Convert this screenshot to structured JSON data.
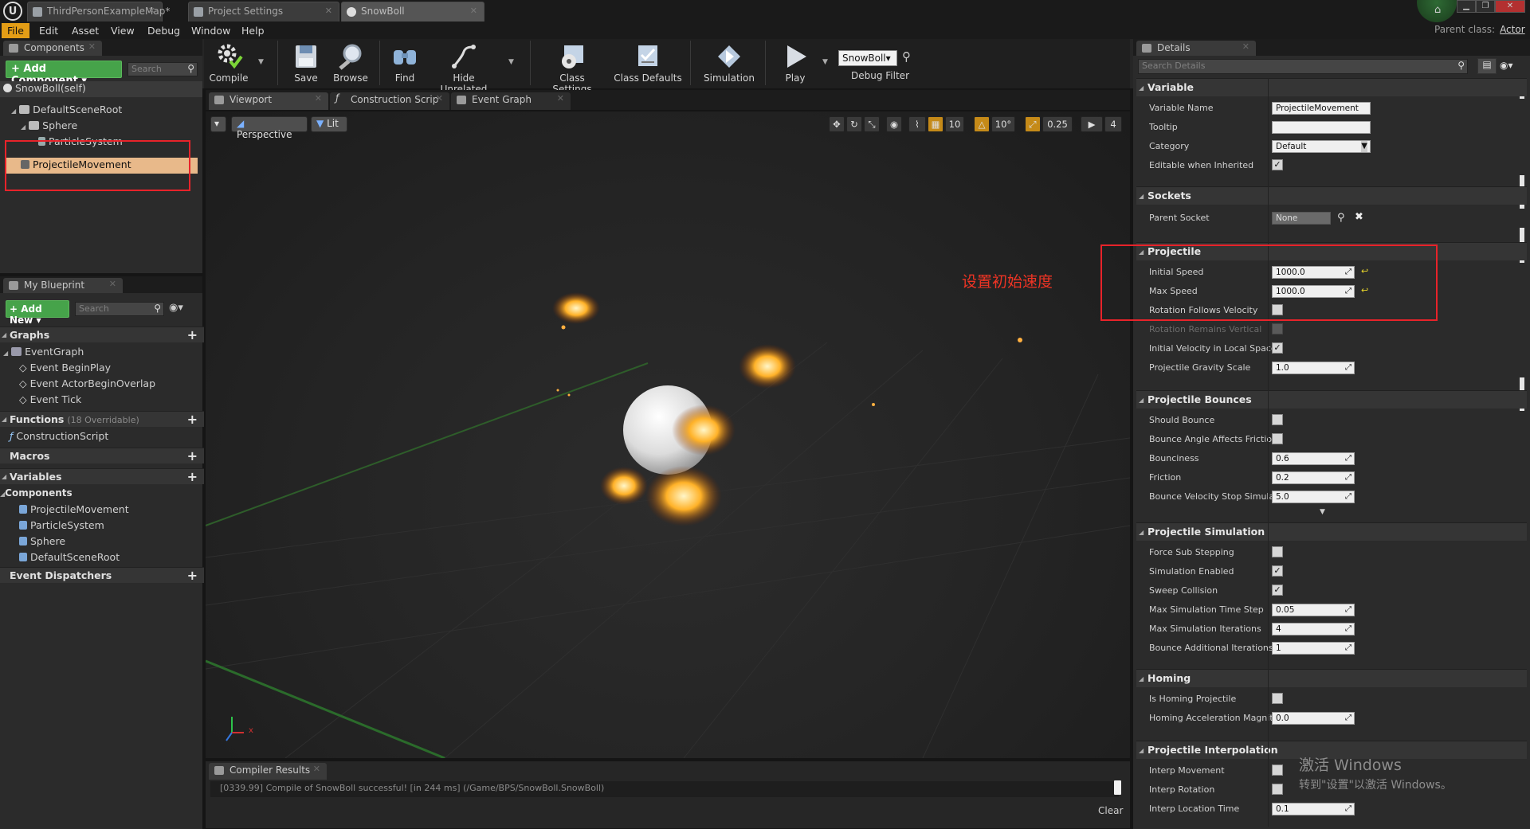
{
  "tabs": [
    {
      "label": "ThirdPersonExampleMap*"
    },
    {
      "label": "Project Settings"
    },
    {
      "label": "SnowBoll"
    }
  ],
  "window": {
    "min": "▁",
    "max": "❐",
    "close": "✕"
  },
  "menu": [
    "File",
    "Edit",
    "Asset",
    "View",
    "Debug",
    "Window",
    "Help"
  ],
  "parent_class": {
    "label": "Parent class:",
    "value": "Actor"
  },
  "toolbar": {
    "compile": "Compile",
    "save": "Save",
    "browse": "Browse",
    "find": "Find",
    "hide_unrelated": "Hide Unrelated",
    "class_settings": "Class Settings",
    "class_defaults": "Class Defaults",
    "simulation": "Simulation",
    "play": "Play",
    "debug_object": "SnowBoll▾",
    "debug_filter": "Debug Filter"
  },
  "components_panel": {
    "tab": "Components",
    "add_button": "+ Add Component ▾",
    "search_placeholder": "Search",
    "self": "SnowBoll(self)",
    "tree": [
      "DefaultSceneRoot",
      "Sphere",
      "ParticleSystem",
      "ProjectileMovement"
    ]
  },
  "my_blueprint": {
    "tab": "My Blueprint",
    "add_new": "+ Add New ▾",
    "search_placeholder": "Search",
    "graphs_header": "Graphs",
    "event_graph": "EventGraph",
    "events": [
      "Event BeginPlay",
      "Event ActorBeginOverlap",
      "Event Tick"
    ],
    "functions_header": "Functions",
    "functions_sub": "(18 Overridable)",
    "functions": [
      "ConstructionScript"
    ],
    "macros_header": "Macros",
    "variables_header": "Variables",
    "components_header": "Components",
    "components": [
      "ProjectileMovement",
      "ParticleSystem",
      "Sphere",
      "DefaultSceneRoot"
    ],
    "dispatchers_header": "Event Dispatchers"
  },
  "editor_tabs": [
    "Viewport",
    "Construction Scrip",
    "Event Graph"
  ],
  "viewport": {
    "perspective": "Perspective",
    "lit": "Lit",
    "grid_snap": "10",
    "rot_snap": "10°",
    "scale_snap": "0.25",
    "cam_speed": "4",
    "axis_x": "x"
  },
  "compiler": {
    "tab": "Compiler Results",
    "message": "[0339.99] Compile of SnowBoll successful! [in 244 ms] (/Game/BPS/SnowBoll.SnowBoll)",
    "clear": "Clear"
  },
  "details": {
    "tab": "Details",
    "search_placeholder": "Search Details",
    "sections": {
      "variable": "Variable",
      "sockets": "Sockets",
      "projectile": "Projectile",
      "bounces": "Projectile Bounces",
      "simulation": "Projectile Simulation",
      "homing": "Homing",
      "interpolation": "Projectile Interpolation"
    },
    "variable_name": {
      "label": "Variable Name",
      "value": "ProjectileMovement"
    },
    "tooltip": {
      "label": "Tooltip",
      "value": ""
    },
    "category": {
      "label": "Category",
      "value": "Default"
    },
    "editable_inherited": {
      "label": "Editable when Inherited"
    },
    "parent_socket": {
      "label": "Parent Socket",
      "value": "None"
    },
    "initial_speed": {
      "label": "Initial Speed",
      "value": "1000.0"
    },
    "max_speed": {
      "label": "Max Speed",
      "value": "1000.0"
    },
    "rot_follows_vel": {
      "label": "Rotation Follows Velocity"
    },
    "rot_remains_vert": {
      "label": "Rotation Remains Vertical"
    },
    "init_vel_local": {
      "label": "Initial Velocity in Local Space"
    },
    "gravity_scale": {
      "label": "Projectile Gravity Scale",
      "value": "1.0"
    },
    "should_bounce": {
      "label": "Should Bounce"
    },
    "bounce_angle": {
      "label": "Bounce Angle Affects Friction"
    },
    "bounciness": {
      "label": "Bounciness",
      "value": "0.6"
    },
    "friction": {
      "label": "Friction",
      "value": "0.2"
    },
    "bounce_stop": {
      "label": "Bounce Velocity Stop Simulat",
      "value": "5.0"
    },
    "force_sub": {
      "label": "Force Sub Stepping"
    },
    "sim_enabled": {
      "label": "Simulation Enabled"
    },
    "sweep": {
      "label": "Sweep Collision"
    },
    "max_sim_step": {
      "label": "Max Simulation Time Step",
      "value": "0.05"
    },
    "max_sim_iter": {
      "label": "Max Simulation Iterations",
      "value": "4"
    },
    "bounce_add_iter": {
      "label": "Bounce Additional Iterations",
      "value": "1"
    },
    "is_homing": {
      "label": "Is Homing Projectile"
    },
    "homing_accel": {
      "label": "Homing Acceleration Magnitu",
      "value": "0.0"
    },
    "interp_movement": {
      "label": "Interp Movement"
    },
    "interp_rotation": {
      "label": "Interp Rotation"
    },
    "interp_loc_time": {
      "label": "Interp Location Time",
      "value": "0.1"
    }
  },
  "annotation": "设置初始速度",
  "watermark": {
    "line1": "激活 Windows",
    "line2": "转到\"设置\"以激活 Windows。"
  },
  "colors": {
    "accent_orange": "#e39d16",
    "add_green": "#46a34a",
    "annotation_red": "#e8232a"
  }
}
